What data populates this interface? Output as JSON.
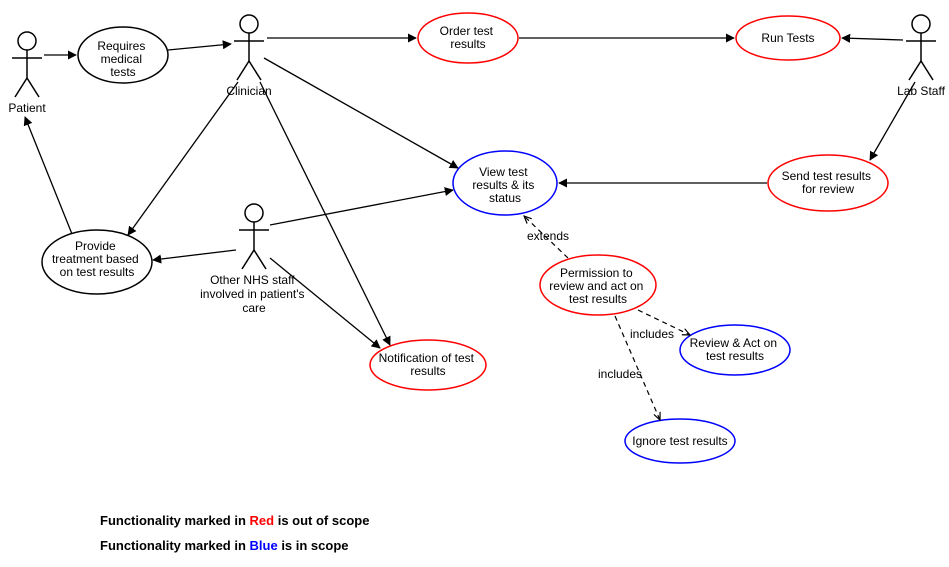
{
  "actors": {
    "patient": {
      "label": "Patient"
    },
    "clinician": {
      "label": "Clinician"
    },
    "other_nhs": {
      "label": "Other NHS staff involved in patient's care"
    },
    "lab_staff": {
      "label": "Lab Staff"
    }
  },
  "usecases": {
    "requires_tests": {
      "label": "Requires medical tests",
      "scope": "neutral"
    },
    "order_tests": {
      "label": "Order test results",
      "scope": "out"
    },
    "run_tests": {
      "label": "Run Tests",
      "scope": "out"
    },
    "view_results": {
      "label": "View test results & its status",
      "scope": "in"
    },
    "send_results": {
      "label": "Send test results for review",
      "scope": "out"
    },
    "provide_treatment": {
      "label": "Provide treatment based on test results",
      "scope": "neutral"
    },
    "notification": {
      "label": "Notification of test results",
      "scope": "out"
    },
    "permission": {
      "label": "Permission to review and act on test results",
      "scope": "out"
    },
    "review_act": {
      "label": "Review & Act on test results",
      "scope": "in"
    },
    "ignore": {
      "label": "Ignore test results",
      "scope": "in"
    }
  },
  "relationships": {
    "extends": "extends",
    "includes": "includes"
  },
  "legend": {
    "out_prefix": "Functionality marked in ",
    "out_word": "Red",
    "out_suffix": " is out of scope",
    "in_prefix": "Functionality marked in ",
    "in_word": "Blue",
    "in_suffix": " is in scope"
  },
  "colors": {
    "out": "#fe0000",
    "in": "#0000fe",
    "neutral": "#000000"
  }
}
